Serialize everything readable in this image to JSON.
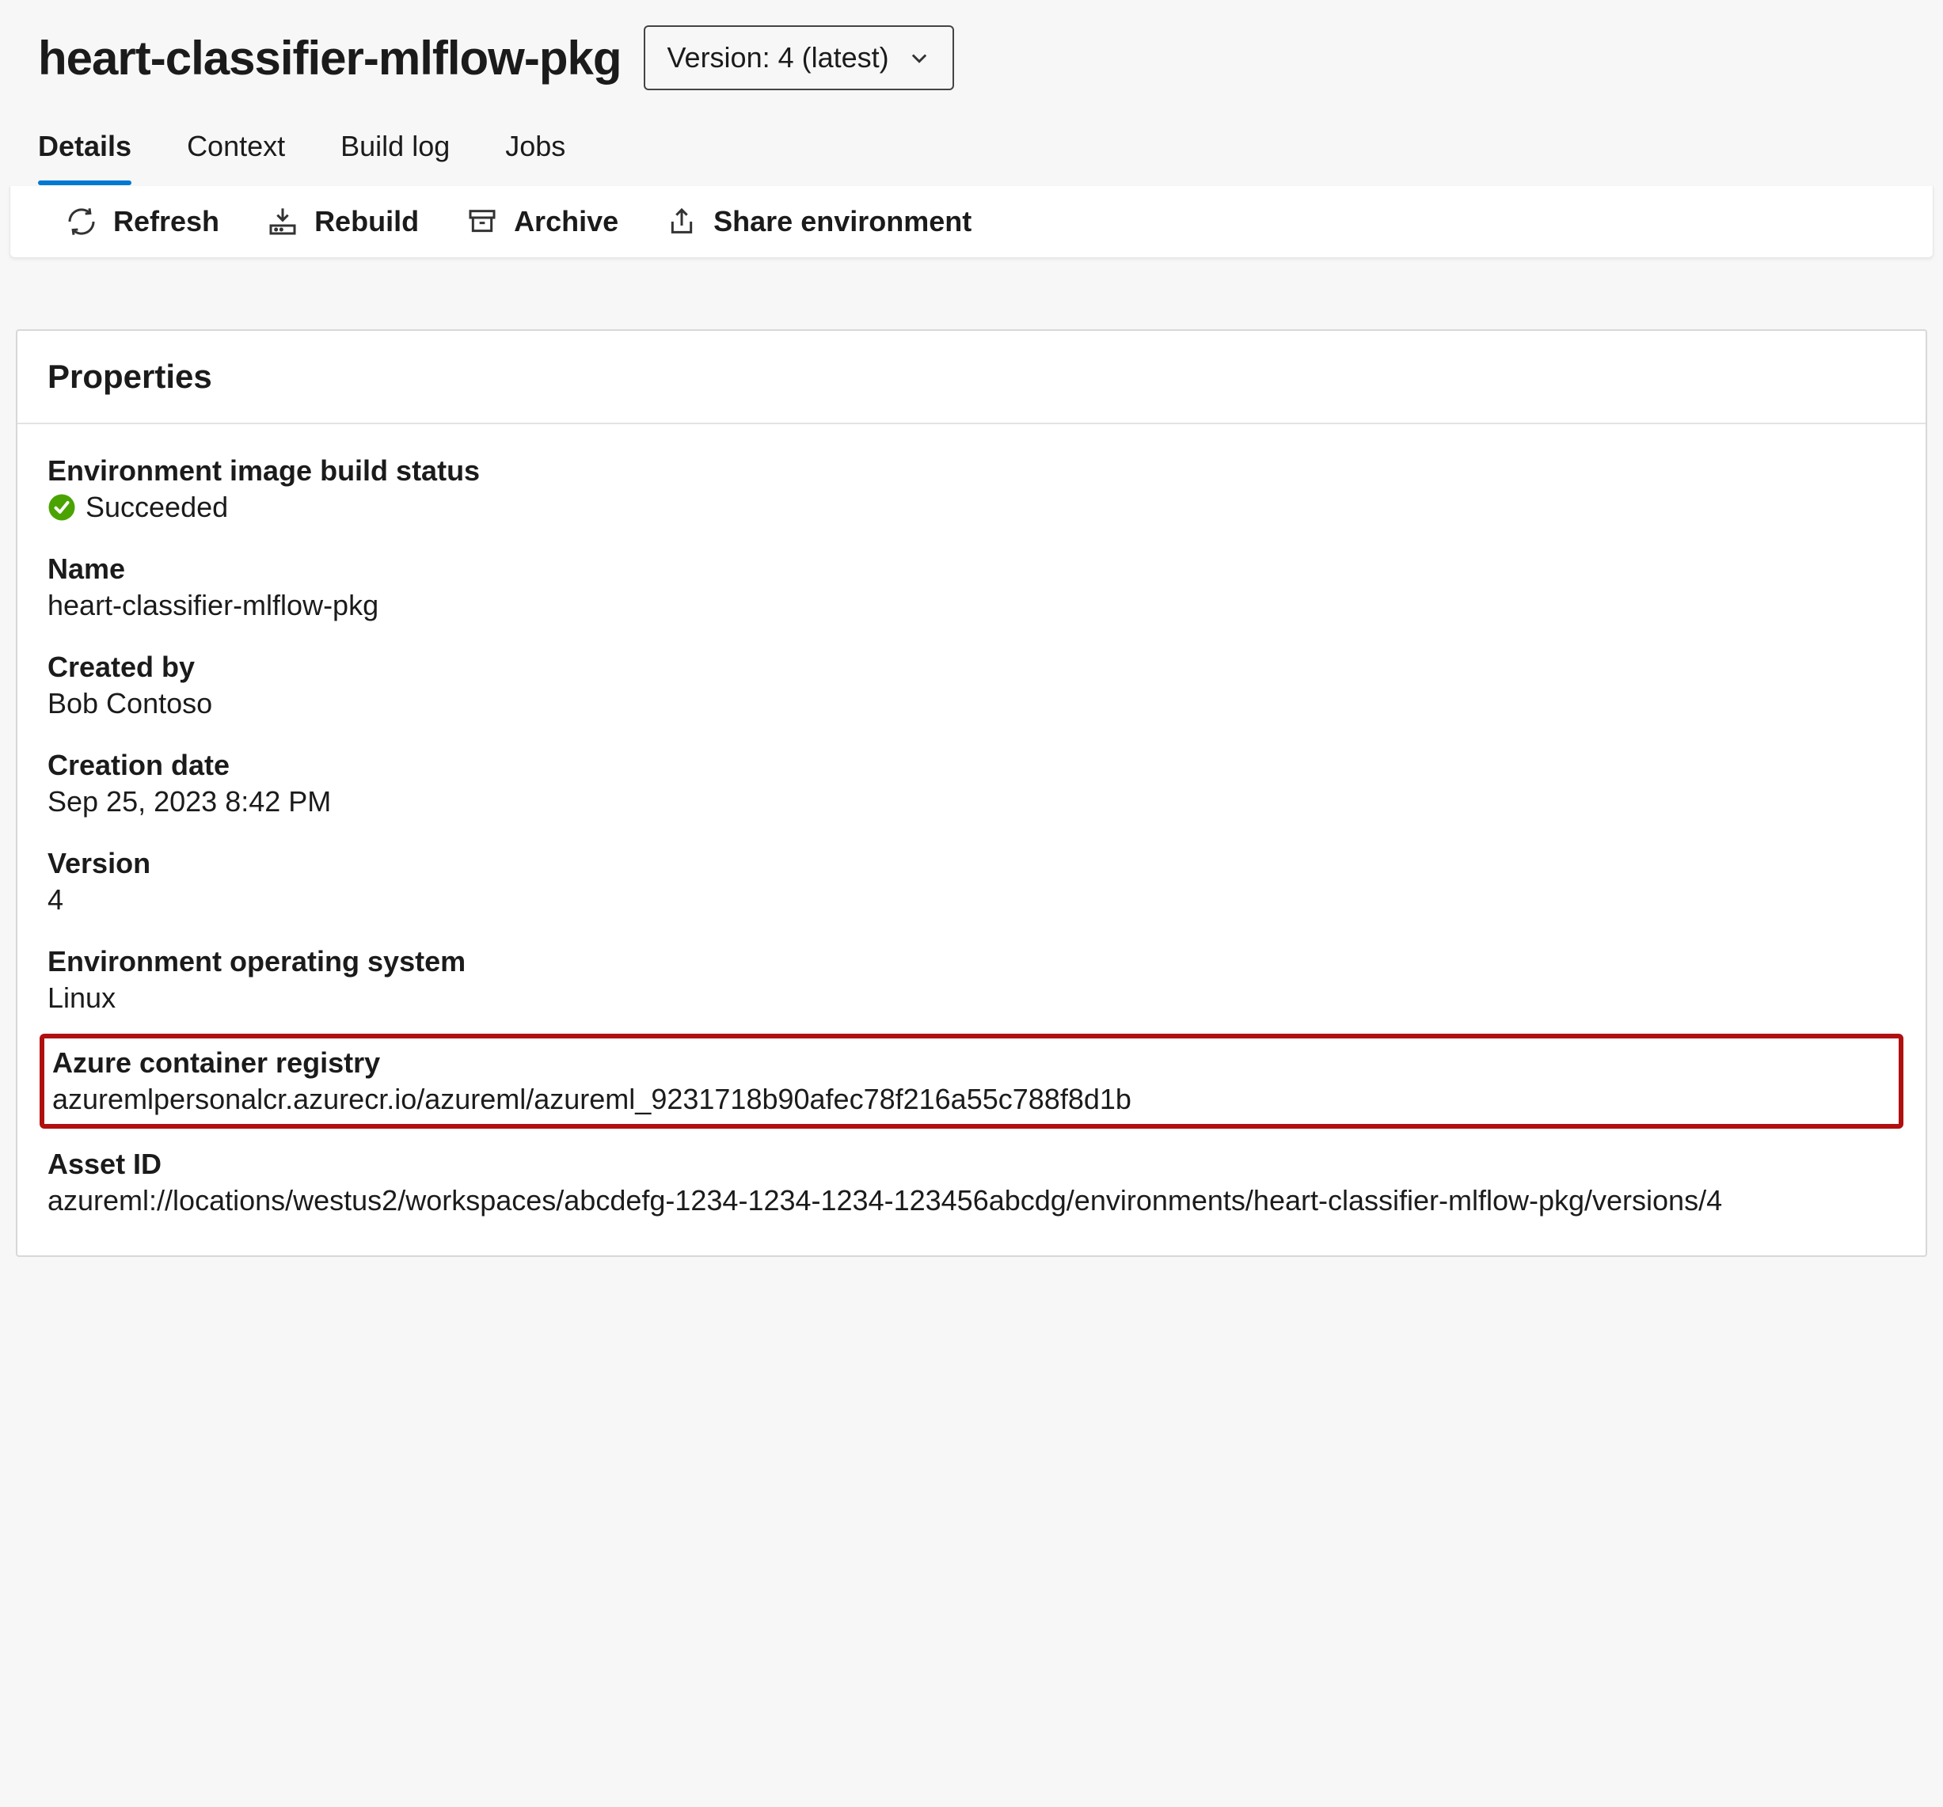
{
  "header": {
    "title": "heart-classifier-mlflow-pkg",
    "version_label": "Version: 4 (latest)"
  },
  "tabs": [
    {
      "label": "Details",
      "active": true
    },
    {
      "label": "Context",
      "active": false
    },
    {
      "label": "Build log",
      "active": false
    },
    {
      "label": "Jobs",
      "active": false
    }
  ],
  "toolbar": {
    "refresh": "Refresh",
    "rebuild": "Rebuild",
    "archive": "Archive",
    "share": "Share environment"
  },
  "panel": {
    "title": "Properties",
    "props": {
      "build_status_label": "Environment image build status",
      "build_status_value": "Succeeded",
      "name_label": "Name",
      "name_value": "heart-classifier-mlflow-pkg",
      "created_by_label": "Created by",
      "created_by_value": "Bob Contoso",
      "creation_date_label": "Creation date",
      "creation_date_value": "Sep 25, 2023 8:42 PM",
      "version_label": "Version",
      "version_value": "4",
      "os_label": "Environment operating system",
      "os_value": "Linux",
      "acr_label": "Azure container registry",
      "acr_value": "azuremlpersonalcr.azurecr.io/azureml/azureml_9231718b90afec78f216a55c788f8d1b",
      "asset_id_label": "Asset ID",
      "asset_id_value": "azureml://locations/westus2/workspaces/abcdefg-1234-1234-1234-123456abcdg/environments/heart-classifier-mlflow-pkg/versions/4"
    }
  }
}
